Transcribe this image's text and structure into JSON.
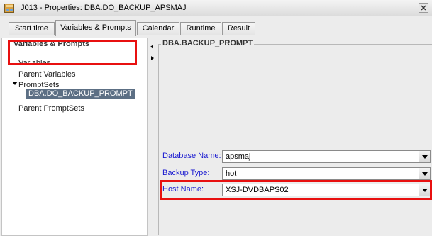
{
  "window": {
    "title": "J013 - Properties: DBA.DO_BACKUP_APSMAJ",
    "icons": [
      "job-icon",
      "close-icon"
    ],
    "highlight_color": "#e81010"
  },
  "tabs": [
    {
      "label": "Start time",
      "active": false
    },
    {
      "label": "Variables & Prompts",
      "active": true
    },
    {
      "label": "Calendar",
      "active": false
    },
    {
      "label": "Runtime",
      "active": false
    },
    {
      "label": "Result",
      "active": false
    }
  ],
  "left_panel": {
    "legend": "Variables & Prompts",
    "items": [
      {
        "label": "Variables"
      },
      {
        "label": "Parent Variables"
      },
      {
        "label": "PromptSets",
        "expanded": true
      },
      {
        "label": "DBA.DO_BACKUP_PROMPT",
        "selected": true
      },
      {
        "label": "Parent PromptSets"
      }
    ]
  },
  "right_panel": {
    "legend": "DBA.BACKUP_PROMPT",
    "fields": [
      {
        "label": "Database Name:",
        "value": "apsmaj"
      },
      {
        "label": "Backup Type:",
        "value": "hot"
      },
      {
        "label": "Host Name:",
        "value": "XSJ-DVDBAPS02"
      }
    ]
  }
}
